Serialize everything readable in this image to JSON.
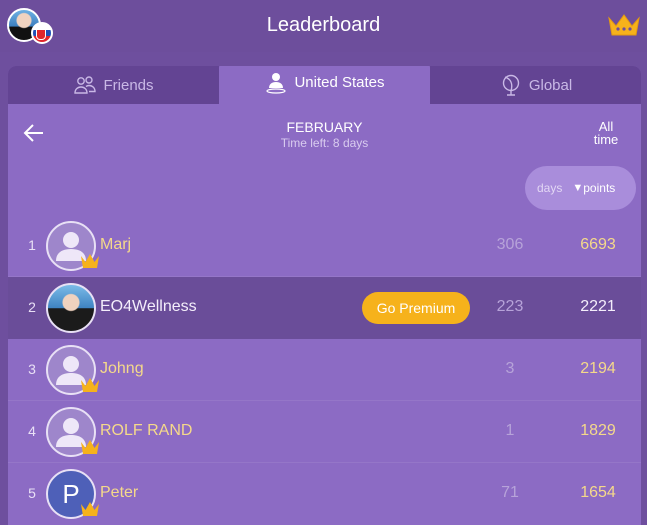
{
  "header": {
    "title": "Leaderboard",
    "crown_color": "#f6b21b"
  },
  "tabs": [
    {
      "label": "Friends",
      "icon": "friends-icon"
    },
    {
      "label": "United States",
      "icon": "user-location-icon",
      "active": true
    },
    {
      "label": "Global",
      "icon": "globe-icon"
    }
  ],
  "period": {
    "month": "FEBRUARY",
    "time_left": "Time left: 8 days",
    "all_time_label": "All time"
  },
  "sort": {
    "days_label": "days",
    "points_label": "points",
    "active": "points"
  },
  "rows": [
    {
      "rank": "1",
      "name": "Marj",
      "days": "306",
      "points": "6693",
      "avatar": "default-avatar-icon"
    },
    {
      "rank": "2",
      "name": "EO4Wellness",
      "days": "223",
      "points": "2221",
      "avatar": "photo",
      "current_user": true,
      "action_label": "Go Premium"
    },
    {
      "rank": "3",
      "name": "Johng",
      "days": "3",
      "points": "2194",
      "avatar": "default-avatar-icon"
    },
    {
      "rank": "4",
      "name": "ROLF RAND",
      "days": "1",
      "points": "1829",
      "avatar": "default-avatar-icon"
    },
    {
      "rank": "5",
      "name": "Peter",
      "days": "71",
      "points": "1654",
      "avatar": "letter",
      "avatar_letter": "P"
    }
  ],
  "colors": {
    "background": "#6e4f9e",
    "panel": "#8c6bc4",
    "highlight_row": "#6a4d99",
    "name_gold": "#f5d98a",
    "premium_button": "#f6b21b"
  }
}
